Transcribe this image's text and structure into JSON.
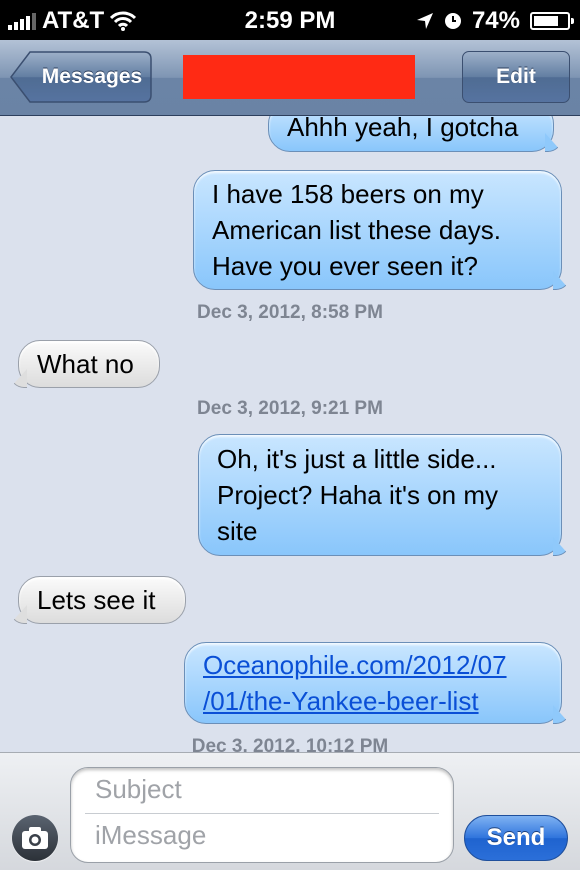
{
  "status_bar": {
    "carrier": "AT&T",
    "time": "2:59 PM",
    "battery": "74%",
    "battery_level": 0.74
  },
  "nav": {
    "back_label": "Messages",
    "edit_label": "Edit",
    "title_redacted": true
  },
  "conversation": {
    "messages": [
      {
        "direction": "outgoing",
        "lines": [
          "Ahhh yeah, I gotcha"
        ]
      },
      {
        "direction": "outgoing",
        "lines": [
          "I have 158 beers on my",
          "American list these days.",
          "Have you ever seen it?"
        ]
      },
      {
        "timestamp": "Dec 3, 2012, 8:58 PM"
      },
      {
        "direction": "incoming",
        "lines": [
          "What no"
        ]
      },
      {
        "timestamp": "Dec 3, 2012, 9:21 PM"
      },
      {
        "direction": "outgoing",
        "lines": [
          "Oh, it's just a little side...",
          "Project? Haha it's on my",
          "site"
        ]
      },
      {
        "direction": "incoming",
        "lines": [
          "Lets see it"
        ]
      },
      {
        "direction": "outgoing",
        "link": true,
        "lines": [
          "Oceanophile.com/2012/07",
          "/01/the-Yankee-beer-list"
        ]
      },
      {
        "timestamp": "Dec 3, 2012, 10:12 PM"
      }
    ]
  },
  "compose": {
    "subject_placeholder": "Subject",
    "message_placeholder": "iMessage",
    "send_label": "Send"
  }
}
